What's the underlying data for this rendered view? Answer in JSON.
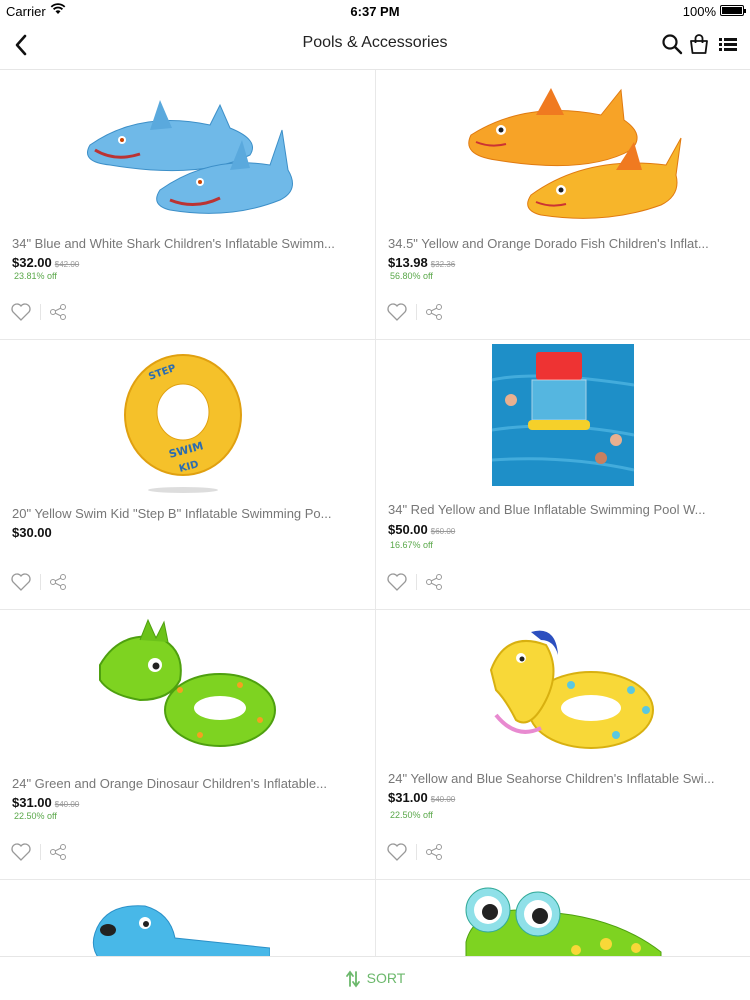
{
  "status": {
    "carrier": "Carrier",
    "time": "6:37 PM",
    "battery": "100%",
    "battery_level": 1.0
  },
  "nav": {
    "title": "Pools & Accessories"
  },
  "products": [
    {
      "name": "34\" Blue and White Shark Children's Inflatable Swimm...",
      "price": "$32.00",
      "old_price": "$42.00",
      "discount": "23.81% off"
    },
    {
      "name": "34.5\" Yellow and Orange Dorado Fish Children's Inflat...",
      "price": "$13.98",
      "old_price": "$32.36",
      "discount": "56.80% off"
    },
    {
      "name": "20\" Yellow Swim Kid \"Step B\" Inflatable Swimming Po...",
      "price": "$30.00",
      "old_price": "",
      "discount": ""
    },
    {
      "name": "34\" Red  Yellow and Blue Inflatable Swimming Pool W...",
      "price": "$50.00",
      "old_price": "$60.00",
      "discount": "16.67% off"
    },
    {
      "name": "24\" Green and Orange Dinosaur Children's Inflatable...",
      "price": "$31.00",
      "old_price": "$40.00",
      "discount": "22.50% off"
    },
    {
      "name": "24\" Yellow and Blue Seahorse Children's Inflatable Swi...",
      "price": "$31.00",
      "old_price": "$40.00",
      "discount": "22.50% off"
    }
  ],
  "bottom": {
    "sort_label": "SORT"
  },
  "colors": {
    "accent": "#6cb86c",
    "discount": "#5aa84a"
  }
}
